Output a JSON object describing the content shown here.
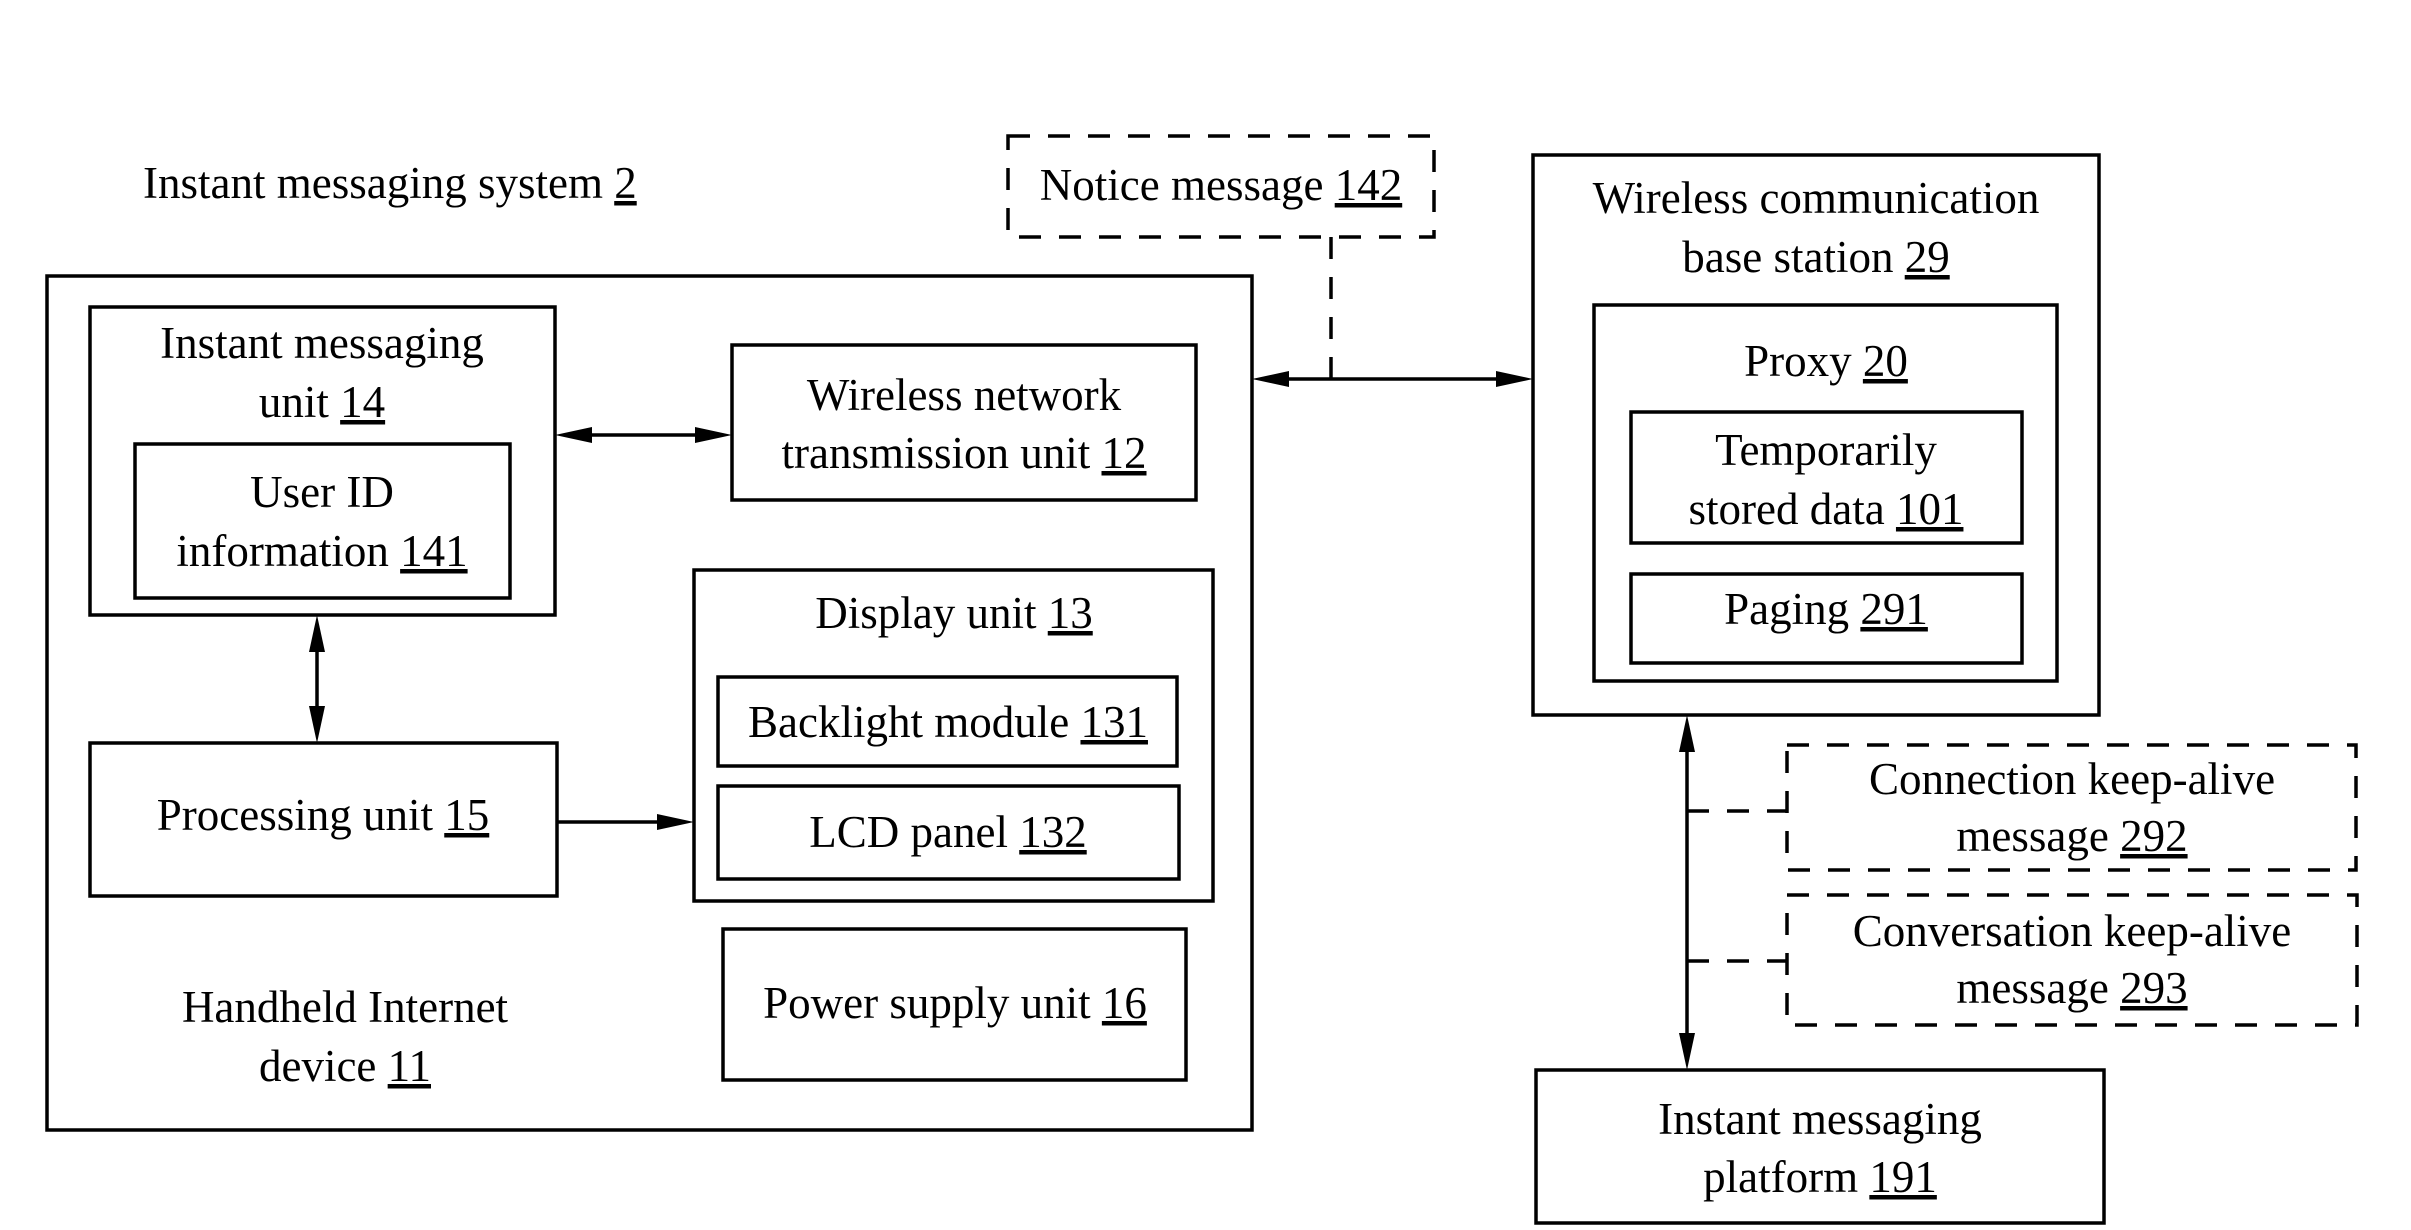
{
  "diagram": {
    "title": {
      "text": "Instant messaging system",
      "ref": "2"
    },
    "notice_message": {
      "line1": "Notice message",
      "ref": "142"
    },
    "handheld_device": {
      "line1": "Handheld Internet",
      "line2": "device",
      "ref": "11"
    },
    "im_unit": {
      "line1": "Instant messaging",
      "line2": "unit",
      "ref": "14"
    },
    "user_id_info": {
      "line1": "User ID",
      "line2": "information",
      "ref": "141"
    },
    "wireless_network_unit": {
      "line1": "Wireless network",
      "line2": "transmission unit",
      "ref": "12"
    },
    "display_unit": {
      "line1": "Display unit",
      "ref": "13"
    },
    "backlight_module": {
      "line1": "Backlight module",
      "ref": "131"
    },
    "lcd_panel": {
      "line1": "LCD panel",
      "ref": "132"
    },
    "processing_unit": {
      "line1": "Processing unit",
      "ref": "15"
    },
    "power_supply_unit": {
      "line1": "Power supply unit",
      "ref": "16"
    },
    "base_station": {
      "line1": "Wireless communication",
      "line2": "base station",
      "ref": "29"
    },
    "proxy": {
      "line1": "Proxy",
      "ref": "20"
    },
    "temp_stored_data": {
      "line1": "Temporarily",
      "line2": "stored data",
      "ref": "101"
    },
    "paging": {
      "line1": "Paging",
      "ref": "291"
    },
    "connection_keepalive": {
      "line1": "Connection keep-alive",
      "line2": "message",
      "ref": "292"
    },
    "conversation_keepalive": {
      "line1": "Conversation keep-alive",
      "line2": "message",
      "ref": "293"
    },
    "im_platform": {
      "line1": "Instant messaging",
      "line2": "platform",
      "ref": "191"
    },
    "connections": [
      {
        "from": "Instant messaging unit 14",
        "to": "Wireless network transmission unit 12",
        "type": "bidirectional"
      },
      {
        "from": "Instant messaging unit 14",
        "to": "Processing unit 15",
        "type": "bidirectional"
      },
      {
        "from": "Processing unit 15",
        "to": "Display unit 13",
        "type": "directed"
      },
      {
        "from": "Handheld Internet device 11",
        "to": "Wireless communication base station 29",
        "type": "bidirectional"
      },
      {
        "from": "Notice message 142",
        "to": "device-base station link",
        "type": "dashed annotation"
      },
      {
        "from": "Wireless communication base station 29",
        "to": "Instant messaging platform 191",
        "type": "bidirectional"
      },
      {
        "from": "Connection keep-alive message 292",
        "to": "base station-platform link",
        "type": "dashed annotation"
      },
      {
        "from": "Conversation keep-alive message 293",
        "to": "base station-platform link",
        "type": "dashed annotation"
      }
    ]
  }
}
